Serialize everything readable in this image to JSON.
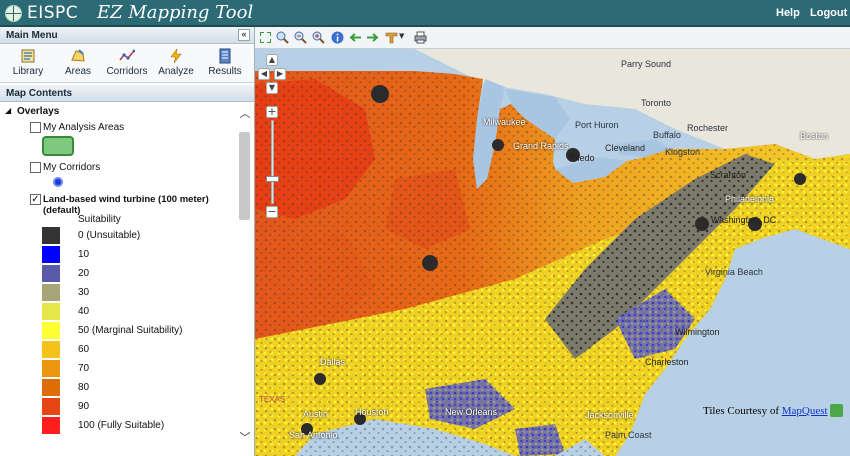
{
  "app": {
    "title_part1": "EISPC",
    "title_part2": "EZ Mapping Tool"
  },
  "header": {
    "help_label": "Help",
    "logout_label": "Logout"
  },
  "main_menu": {
    "title": "Main Menu",
    "collapse_glyph": "«",
    "buttons": [
      {
        "label": "Library",
        "icon": "library-icon"
      },
      {
        "label": "Areas",
        "icon": "areas-icon"
      },
      {
        "label": "Corridors",
        "icon": "corridors-icon"
      },
      {
        "label": "Analyze",
        "icon": "analyze-icon"
      },
      {
        "label": "Results",
        "icon": "results-icon"
      }
    ]
  },
  "map_contents": {
    "title": "Map Contents",
    "overlays_label": "Overlays",
    "items": [
      {
        "label": "My Analysis Areas",
        "checked": false
      },
      {
        "label": "My Corridors",
        "checked": false
      },
      {
        "label": "Land-based wind turbine (100 meter) (default)",
        "checked": true
      }
    ],
    "legend_title": "Suitability",
    "legend": [
      {
        "label": "0 (Unsuitable)",
        "color": "#333333"
      },
      {
        "label": "10",
        "color": "#0000ff"
      },
      {
        "label": "20",
        "color": "#5a5aaa"
      },
      {
        "label": "30",
        "color": "#a5a577"
      },
      {
        "label": "40",
        "color": "#e6e64a"
      },
      {
        "label": "50 (Marginal Suitability)",
        "color": "#ffff33"
      },
      {
        "label": "60",
        "color": "#f5c21b"
      },
      {
        "label": "70",
        "color": "#eb960e"
      },
      {
        "label": "80",
        "color": "#dc6e05"
      },
      {
        "label": "90",
        "color": "#e64614"
      },
      {
        "label": "100 (Fully Suitable)",
        "color": "#ff1e1e"
      }
    ]
  },
  "map": {
    "credit_prefix": "Tiles Courtesy of",
    "credit_link": "MapQuest",
    "cities": [
      "Parry Sound",
      "Milwaukee",
      "Grand Rapids",
      "Port Huron",
      "Toronto",
      "Rochester",
      "Boston",
      "Buffalo",
      "Toledo",
      "Cleveland",
      "Scranton",
      "Philadelphia",
      "Washington, DC",
      "Virginia Beach",
      "Dallas",
      "Austin",
      "San Antonio",
      "Houston",
      "New Orleans",
      "Jacksonville",
      "Palm Coast",
      "Charleston",
      "Wilmington",
      "Kingston"
    ],
    "texas_label": "TEXAS"
  }
}
